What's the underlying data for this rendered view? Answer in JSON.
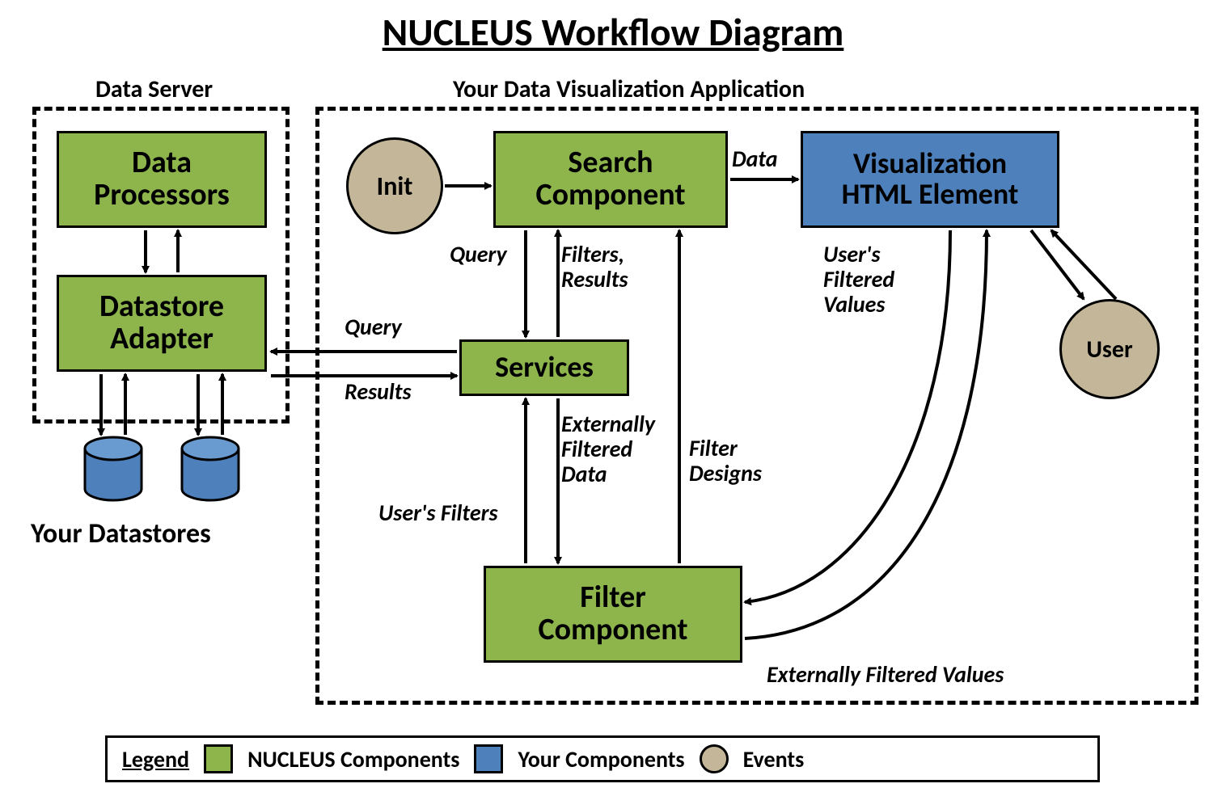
{
  "title": "NUCLEUS Workflow Diagram",
  "groups": {
    "data_server": "Data Server",
    "viz_app": "Your Data Visualization Application"
  },
  "boxes": {
    "data_processors": "Data\nProcessors",
    "datastore_adapter": "Datastore\nAdapter",
    "search_component": "Search\nComponent",
    "services": "Services",
    "filter_component": "Filter\nComponent",
    "viz_element": "Visualization\nHTML Element"
  },
  "circles": {
    "init": "Init",
    "user": "User"
  },
  "labels": {
    "data": "Data",
    "query1": "Query",
    "filters_results": "Filters,\nResults",
    "query2": "Query",
    "results": "Results",
    "users_filters": "User's Filters",
    "externally_filtered_data": "Externally\nFiltered\nData",
    "filter_designs": "Filter\nDesigns",
    "users_filtered_values": "User's\nFiltered\nValues",
    "externally_filtered_values": "Externally Filtered Values"
  },
  "datastores_label": "Your Datastores",
  "legend": {
    "title": "Legend",
    "nucleus": "NUCLEUS Components",
    "yours": "Your Components",
    "events": "Events"
  },
  "colors": {
    "green": "#8db54c",
    "blue": "#4e80bb",
    "tan": "#c4b799"
  }
}
